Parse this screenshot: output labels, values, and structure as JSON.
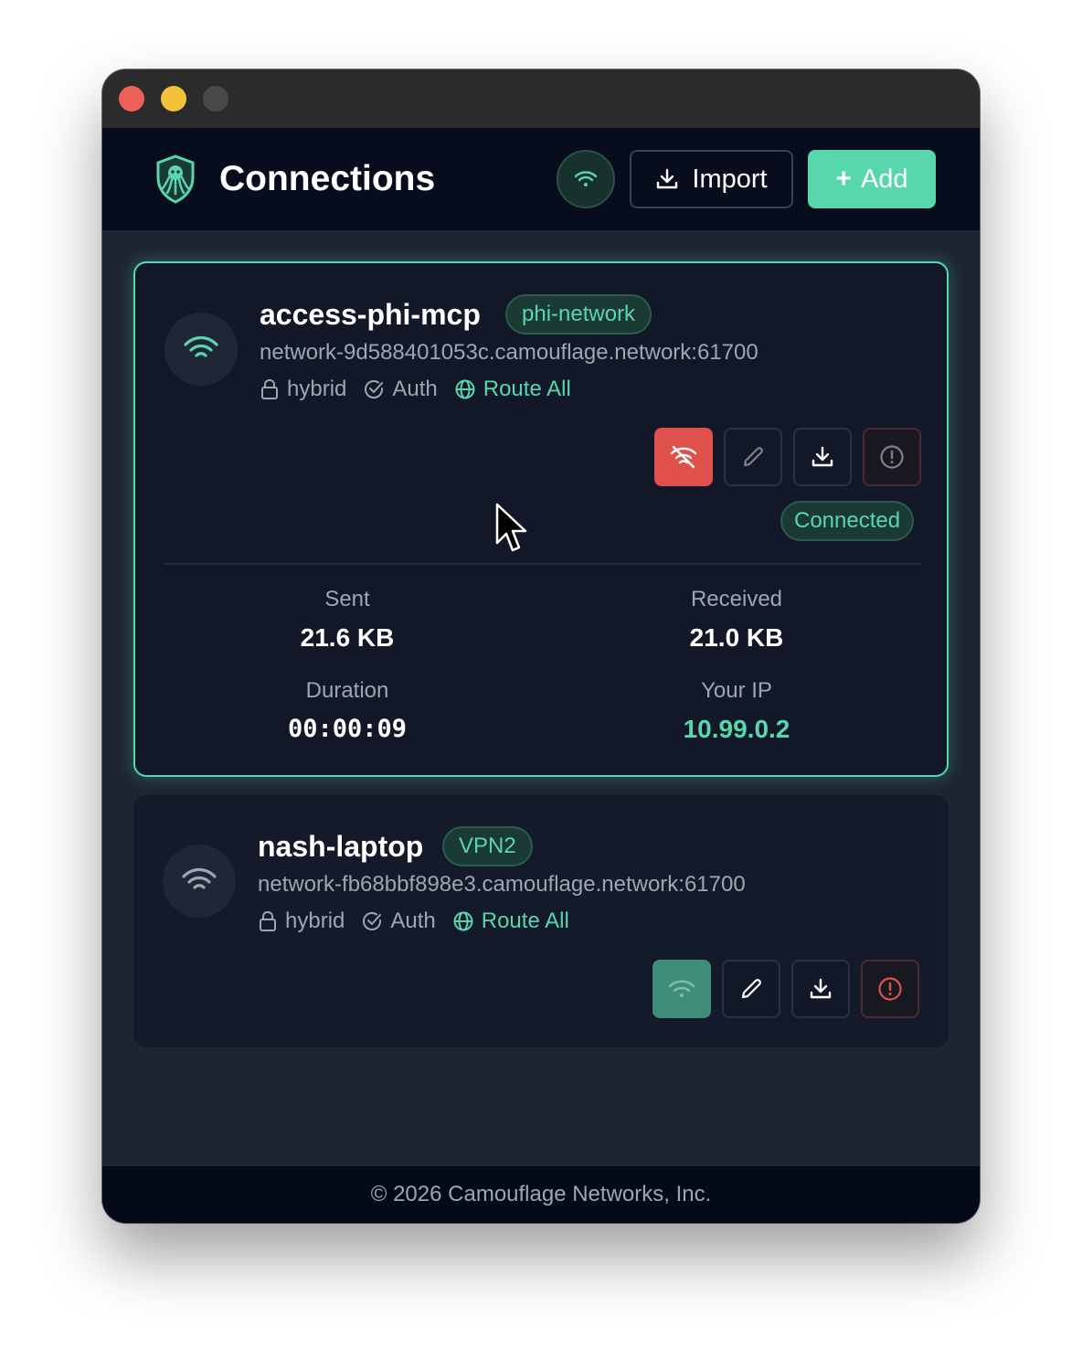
{
  "header": {
    "title": "Connections",
    "import_label": "Import",
    "add_label": "Add",
    "add_icon": "+"
  },
  "connections": [
    {
      "name": "access-phi-mcp",
      "network": "phi-network",
      "host": "network-9d588401053c.camouflage.network:61700",
      "mode": "hybrid",
      "auth": "Auth",
      "route": "Route All",
      "status": "Connected",
      "stats": {
        "sent_label": "Sent",
        "sent": "21.6 KB",
        "received_label": "Received",
        "received": "21.0 KB",
        "duration_label": "Duration",
        "duration": "00:00:09",
        "ip_label": "Your IP",
        "ip": "10.99.0.2"
      }
    },
    {
      "name": "nash-laptop",
      "network": "VPN2",
      "host": "network-fb68bbf898e3.camouflage.network:61700",
      "mode": "hybrid",
      "auth": "Auth",
      "route": "Route All"
    }
  ],
  "footer": {
    "copyright": "© 2026 Camouflage Networks, Inc."
  },
  "colors": {
    "accent": "#58d6ad",
    "danger": "#e0514c",
    "connect_button": "#3e8e77",
    "background": "#1e2532",
    "card": "#121827",
    "header": "#070d1c"
  },
  "icons": {
    "logo": "octopus-shield-icon",
    "wifi": "wifi-icon",
    "wifi_off": "wifi-off-icon",
    "import": "download-icon",
    "edit": "pencil-icon",
    "export": "download-icon",
    "delete": "alert-circle-icon",
    "lock": "lock-icon",
    "auth": "check-circle-icon",
    "route": "globe-icon"
  }
}
